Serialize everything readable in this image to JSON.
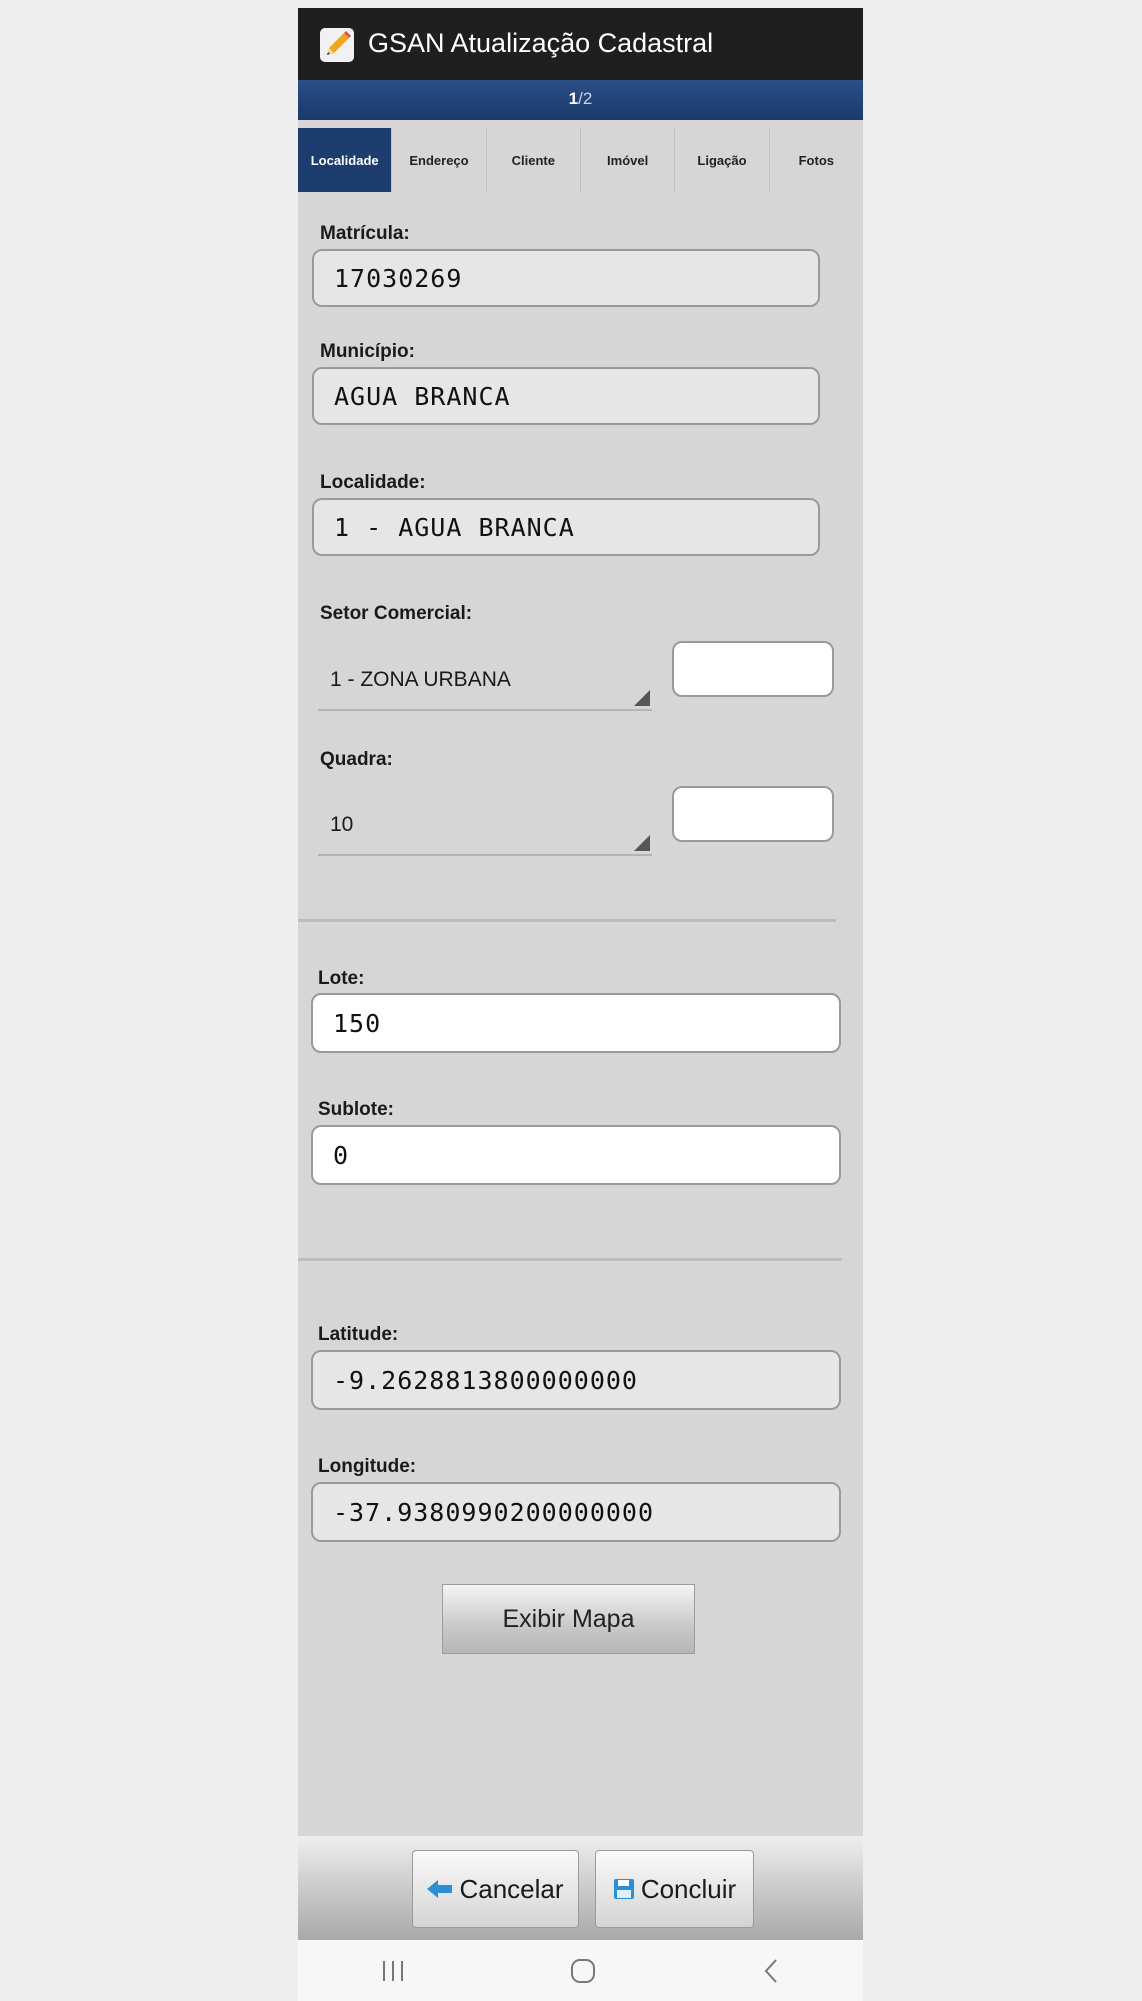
{
  "app": {
    "title": "GSAN Atualização Cadastral",
    "icon": "pencil-icon"
  },
  "pager": {
    "current": "1",
    "total": "/2"
  },
  "tabs": [
    {
      "label": "Localidade",
      "active": true
    },
    {
      "label": "Endereço"
    },
    {
      "label": "Cliente"
    },
    {
      "label": "Imóvel"
    },
    {
      "label": "Ligação"
    },
    {
      "label": "Fotos"
    }
  ],
  "form": {
    "matricula": {
      "label": "Matrícula:",
      "value": "17030269"
    },
    "municipio": {
      "label": "Município:",
      "value": "AGUA  BRANCA"
    },
    "localidade": {
      "label": "Localidade:",
      "value": "1  -  AGUA  BRANCA"
    },
    "setor": {
      "label": "Setor Comercial:",
      "selected": "1 - ZONA URBANA",
      "input": ""
    },
    "quadra": {
      "label": "Quadra:",
      "selected": "10",
      "input": ""
    },
    "lote": {
      "label": "Lote:",
      "value": "150"
    },
    "sublote": {
      "label": "Sublote:",
      "value": "0"
    },
    "latitude": {
      "label": "Latitude:",
      "value": "-9.2628813800000000"
    },
    "longitude": {
      "label": "Longitude:",
      "value": "-37.9380990200000000"
    }
  },
  "buttons": {
    "map": "Exibir Mapa",
    "cancel": "Cancelar",
    "finish": "Concluir"
  },
  "colors": {
    "accent": "#1d3d6e",
    "bar": "#1f1f1f",
    "background": "#d6d6d6"
  }
}
